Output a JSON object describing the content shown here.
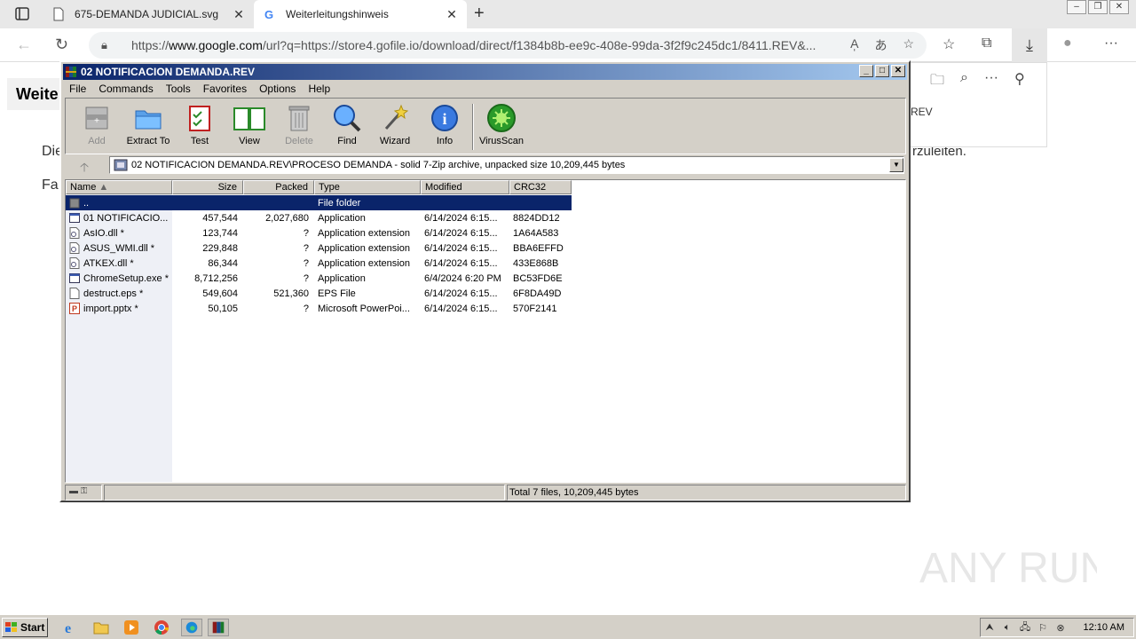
{
  "browser": {
    "tabs": [
      {
        "title": "675-DEMANDA JUDICIAL.svg",
        "active": false
      },
      {
        "title": "Weiterleitungshinweis",
        "active": true
      }
    ],
    "url_prefix": "https://",
    "url_host": "www.google.com",
    "url_rest": "/url?q=https://store4.gofile.io/download/direct/f1384b8b-ee9c-408e-99da-3f2f9c245dc1/8411.REV&...",
    "win_buttons": [
      "–",
      "❐",
      "✕"
    ]
  },
  "page": {
    "heading": "Weite",
    "text1": "Die",
    "text2": "Fa",
    "right_text": "rzuleiten.",
    "download_panel_text": "REV"
  },
  "winrar": {
    "title": "02 NOTIFICACION DEMANDA.REV",
    "menu": [
      "File",
      "Commands",
      "Tools",
      "Favorites",
      "Options",
      "Help"
    ],
    "toolbar": [
      {
        "label": "Add",
        "icon": "add-icon",
        "enabled": false
      },
      {
        "label": "Extract To",
        "icon": "extract-icon",
        "enabled": true
      },
      {
        "label": "Test",
        "icon": "test-icon",
        "enabled": true
      },
      {
        "label": "View",
        "icon": "view-icon",
        "enabled": true
      },
      {
        "label": "Delete",
        "icon": "delete-icon",
        "enabled": false
      },
      {
        "label": "Find",
        "icon": "find-icon",
        "enabled": true
      },
      {
        "label": "Wizard",
        "icon": "wizard-icon",
        "enabled": true
      },
      {
        "label": "Info",
        "icon": "info-icon",
        "enabled": true
      },
      {
        "label": "VirusScan",
        "icon": "virusscan-icon",
        "enabled": true
      }
    ],
    "path": "02 NOTIFICACION DEMANDA.REV\\PROCESO DEMANDA - solid 7-Zip archive, unpacked size 10,209,445 bytes",
    "columns": [
      "Name",
      "Size",
      "Packed",
      "Type",
      "Modified",
      "CRC32"
    ],
    "files": [
      {
        "name": "..",
        "size": "",
        "packed": "",
        "type": "File folder",
        "modified": "",
        "crc": "",
        "icon": "folder-up",
        "selected": true
      },
      {
        "name": "01 NOTIFICACIO...",
        "size": "457,544",
        "packed": "2,027,680",
        "type": "Application",
        "modified": "6/14/2024 6:15...",
        "crc": "8824DD12",
        "icon": "exe"
      },
      {
        "name": "AsIO.dll *",
        "size": "123,744",
        "packed": "?",
        "type": "Application extension",
        "modified": "6/14/2024 6:15...",
        "crc": "1A64A583",
        "icon": "dll"
      },
      {
        "name": "ASUS_WMI.dll *",
        "size": "229,848",
        "packed": "?",
        "type": "Application extension",
        "modified": "6/14/2024 6:15...",
        "crc": "BBA6EFFD",
        "icon": "dll"
      },
      {
        "name": "ATKEX.dll *",
        "size": "86,344",
        "packed": "?",
        "type": "Application extension",
        "modified": "6/14/2024 6:15...",
        "crc": "433E868B",
        "icon": "dll"
      },
      {
        "name": "ChromeSetup.exe *",
        "size": "8,712,256",
        "packed": "?",
        "type": "Application",
        "modified": "6/4/2024 6:20 PM",
        "crc": "BC53FD6E",
        "icon": "exe"
      },
      {
        "name": "destruct.eps *",
        "size": "549,604",
        "packed": "521,360",
        "type": "EPS File",
        "modified": "6/14/2024 6:15...",
        "crc": "6F8DA49D",
        "icon": "file"
      },
      {
        "name": "import.pptx *",
        "size": "50,105",
        "packed": "?",
        "type": "Microsoft PowerPoi...",
        "modified": "6/14/2024 6:15...",
        "crc": "570F2141",
        "icon": "pptx"
      }
    ],
    "status": "Total 7 files, 10,209,445 bytes"
  },
  "taskbar": {
    "start": "Start",
    "clock": "12:10 AM"
  },
  "watermark": "ANY RUN"
}
